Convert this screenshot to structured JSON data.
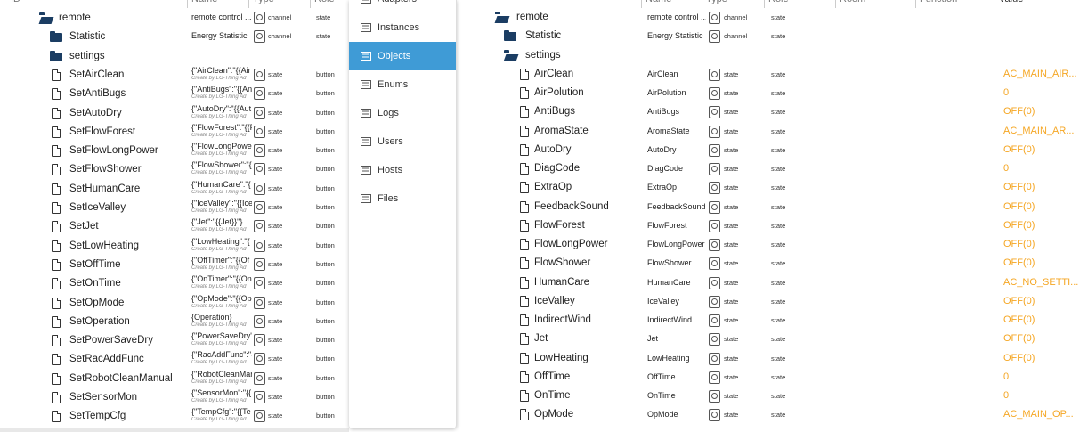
{
  "left": {
    "header": [
      "ID",
      "Name",
      "Type",
      "Role"
    ],
    "rows": [
      {
        "id": "remote",
        "name": "remote control ...",
        "sub": "",
        "type": "channel",
        "role": "state",
        "kind": "folder-open",
        "indent": 0
      },
      {
        "id": "Statistic",
        "name": "Energy Statistic",
        "sub": "",
        "type": "channel",
        "role": "state",
        "kind": "folder",
        "indent": 1
      },
      {
        "id": "settings",
        "name": "",
        "sub": "",
        "type": "",
        "role": "",
        "kind": "folder",
        "indent": 1
      },
      {
        "id": "SetAirClean",
        "name": "{\"AirClean\":\"{{Air",
        "sub": "Create by LG-Thing Ad",
        "type": "state",
        "role": "button",
        "kind": "file",
        "indent": 1
      },
      {
        "id": "SetAntiBugs",
        "name": "{\"AntiBugs\":\"{{An",
        "sub": "Create by LG-Thing Ad",
        "type": "state",
        "role": "button",
        "kind": "file",
        "indent": 1
      },
      {
        "id": "SetAutoDry",
        "name": "{\"AutoDry\":\"{{Aut",
        "sub": "Create by LG-Thing Ad",
        "type": "state",
        "role": "button",
        "kind": "file",
        "indent": 1
      },
      {
        "id": "SetFlowForest",
        "name": "{\"FlowForest\":\"{{F",
        "sub": "Create by LG-Thing Ad",
        "type": "state",
        "role": "button",
        "kind": "file",
        "indent": 1
      },
      {
        "id": "SetFlowLongPower",
        "name": "{\"FlowLongPower",
        "sub": "Create by LG-Thing Ad",
        "type": "state",
        "role": "button",
        "kind": "file",
        "indent": 1
      },
      {
        "id": "SetFlowShower",
        "name": "{\"FlowShower\":\"{",
        "sub": "Create by LG-Thing Ad",
        "type": "state",
        "role": "button",
        "kind": "file",
        "indent": 1
      },
      {
        "id": "SetHumanCare",
        "name": "{\"HumanCare\":\"{",
        "sub": "Create by LG-Thing Ad",
        "type": "state",
        "role": "button",
        "kind": "file",
        "indent": 1
      },
      {
        "id": "SetIceValley",
        "name": "{\"IceValley\":\"{{Ice",
        "sub": "Create by LG-Thing Ad",
        "type": "state",
        "role": "button",
        "kind": "file",
        "indent": 1
      },
      {
        "id": "SetJet",
        "name": "{\"Jet\":\"{{Jet}}\"}",
        "sub": "Create by LG-Thing Ad",
        "type": "state",
        "role": "button",
        "kind": "file",
        "indent": 1
      },
      {
        "id": "SetLowHeating",
        "name": "{\"LowHeating\":\"{",
        "sub": "Create by LG-Thing Ad",
        "type": "state",
        "role": "button",
        "kind": "file",
        "indent": 1
      },
      {
        "id": "SetOffTime",
        "name": "{\"OffTimer\":\"{{Of",
        "sub": "Create by LG-Thing Ad",
        "type": "state",
        "role": "button",
        "kind": "file",
        "indent": 1
      },
      {
        "id": "SetOnTime",
        "name": "{\"OnTimer\":\"{{On",
        "sub": "Create by LG-Thing Ad",
        "type": "state",
        "role": "button",
        "kind": "file",
        "indent": 1
      },
      {
        "id": "SetOpMode",
        "name": "{\"OpMode\":\"{{Op",
        "sub": "Create by LG-Thing Ad",
        "type": "state",
        "role": "button",
        "kind": "file",
        "indent": 1
      },
      {
        "id": "SetOperation",
        "name": "{Operation}",
        "sub": "Create by LG-Thing Ad",
        "type": "state",
        "role": "button",
        "kind": "file",
        "indent": 1
      },
      {
        "id": "SetPowerSaveDry",
        "name": "{\"PowerSaveDry\"",
        "sub": "Create by LG-Thing Ad",
        "type": "state",
        "role": "button",
        "kind": "file",
        "indent": 1
      },
      {
        "id": "SetRacAddFunc",
        "name": "{\"RacAddFunc\":\"{",
        "sub": "Create by LG-Thing Ad",
        "type": "state",
        "role": "button",
        "kind": "file",
        "indent": 1
      },
      {
        "id": "SetRobotCleanManual",
        "name": "{\"RobotCleanMar",
        "sub": "Create by LG-Thing Ad",
        "type": "state",
        "role": "button",
        "kind": "file",
        "indent": 1
      },
      {
        "id": "SetSensorMon",
        "name": "{\"SensorMon\":\"{{",
        "sub": "Create by LG-Thing Ad",
        "type": "state",
        "role": "button",
        "kind": "file",
        "indent": 1
      },
      {
        "id": "SetTempCfg",
        "name": "{\"TempCfg\":\"{{Te",
        "sub": "Create by LG-Thing Ad",
        "type": "state",
        "role": "button",
        "kind": "file",
        "indent": 1
      }
    ]
  },
  "menu": {
    "items": [
      {
        "label": "Adapters",
        "icon": "adapters-icon",
        "active": false
      },
      {
        "label": "Instances",
        "icon": "instances-icon",
        "active": false
      },
      {
        "label": "Objects",
        "icon": "objects-icon",
        "active": true
      },
      {
        "label": "Enums",
        "icon": "enums-icon",
        "active": false
      },
      {
        "label": "Logs",
        "icon": "logs-icon",
        "active": false
      },
      {
        "label": "Users",
        "icon": "users-icon",
        "active": false
      },
      {
        "label": "Hosts",
        "icon": "hosts-icon",
        "active": false
      },
      {
        "label": "Files",
        "icon": "files-icon",
        "active": false
      }
    ]
  },
  "right": {
    "header": [
      "Name",
      "Type",
      "Role",
      "Room",
      "Function",
      "Value"
    ],
    "rows": [
      {
        "id": "remote",
        "name": "remote control ...",
        "type": "channel",
        "role": "state",
        "value": "",
        "kind": "folder-open",
        "indent": 0
      },
      {
        "id": "Statistic",
        "name": "Energy Statistic",
        "type": "channel",
        "role": "state",
        "value": "",
        "kind": "folder",
        "indent": 1
      },
      {
        "id": "settings",
        "name": "",
        "type": "",
        "role": "",
        "value": "",
        "kind": "folder-open",
        "indent": 1
      },
      {
        "id": "AirClean",
        "name": "AirClean",
        "type": "state",
        "role": "state",
        "value": "AC_MAIN_AIR...",
        "kind": "file",
        "indent": 2
      },
      {
        "id": "AirPolution",
        "name": "AirPolution",
        "type": "state",
        "role": "state",
        "value": "0",
        "kind": "file",
        "indent": 2
      },
      {
        "id": "AntiBugs",
        "name": "AntiBugs",
        "type": "state",
        "role": "state",
        "value": "OFF(0)",
        "kind": "file",
        "indent": 2
      },
      {
        "id": "AromaState",
        "name": "AromaState",
        "type": "state",
        "role": "state",
        "value": "AC_MAIN_AR...",
        "kind": "file",
        "indent": 2
      },
      {
        "id": "AutoDry",
        "name": "AutoDry",
        "type": "state",
        "role": "state",
        "value": "OFF(0)",
        "kind": "file",
        "indent": 2
      },
      {
        "id": "DiagCode",
        "name": "DiagCode",
        "type": "state",
        "role": "state",
        "value": "0",
        "kind": "file",
        "indent": 2
      },
      {
        "id": "ExtraOp",
        "name": "ExtraOp",
        "type": "state",
        "role": "state",
        "value": "OFF(0)",
        "kind": "file",
        "indent": 2
      },
      {
        "id": "FeedbackSound",
        "name": "FeedbackSound",
        "type": "state",
        "role": "state",
        "value": "OFF(0)",
        "kind": "file",
        "indent": 2
      },
      {
        "id": "FlowForest",
        "name": "FlowForest",
        "type": "state",
        "role": "state",
        "value": "OFF(0)",
        "kind": "file",
        "indent": 2
      },
      {
        "id": "FlowLongPower",
        "name": "FlowLongPower",
        "type": "state",
        "role": "state",
        "value": "OFF(0)",
        "kind": "file",
        "indent": 2
      },
      {
        "id": "FlowShower",
        "name": "FlowShower",
        "type": "state",
        "role": "state",
        "value": "OFF(0)",
        "kind": "file",
        "indent": 2
      },
      {
        "id": "HumanCare",
        "name": "HumanCare",
        "type": "state",
        "role": "state",
        "value": "AC_NO_SETTI...",
        "kind": "file",
        "indent": 2
      },
      {
        "id": "IceValley",
        "name": "IceValley",
        "type": "state",
        "role": "state",
        "value": "OFF(0)",
        "kind": "file",
        "indent": 2
      },
      {
        "id": "IndirectWind",
        "name": "IndirectWind",
        "type": "state",
        "role": "state",
        "value": "OFF(0)",
        "kind": "file",
        "indent": 2
      },
      {
        "id": "Jet",
        "name": "Jet",
        "type": "state",
        "role": "state",
        "value": "OFF(0)",
        "kind": "file",
        "indent": 2
      },
      {
        "id": "LowHeating",
        "name": "LowHeating",
        "type": "state",
        "role": "state",
        "value": "OFF(0)",
        "kind": "file",
        "indent": 2
      },
      {
        "id": "OffTime",
        "name": "OffTime",
        "type": "state",
        "role": "state",
        "value": "0",
        "kind": "file",
        "indent": 2
      },
      {
        "id": "OnTime",
        "name": "OnTime",
        "type": "state",
        "role": "state",
        "value": "0",
        "kind": "file",
        "indent": 2
      },
      {
        "id": "OpMode",
        "name": "OpMode",
        "type": "state",
        "role": "state",
        "value": "AC_MAIN_OP...",
        "kind": "file",
        "indent": 2
      }
    ]
  },
  "colors": {
    "accent": "#3f9bd6",
    "value": "#f5a623",
    "folder": "#1b3d63"
  }
}
